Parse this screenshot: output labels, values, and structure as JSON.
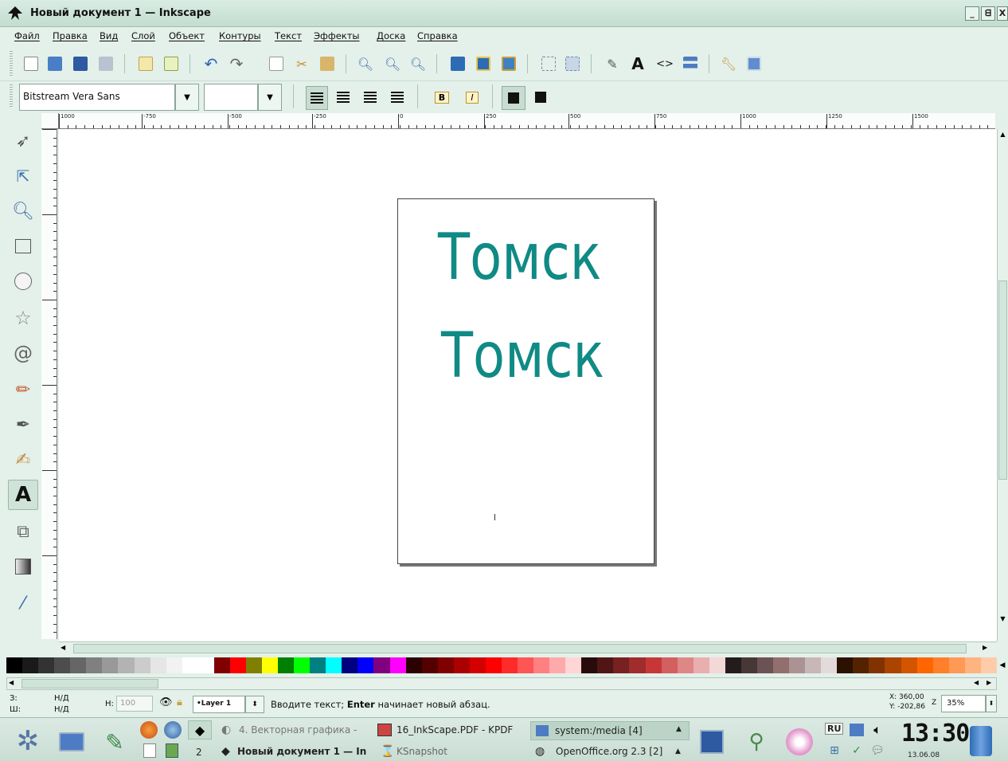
{
  "window": {
    "title": "Новый документ 1 — Inkscape",
    "controls": [
      "_",
      "ᗺ",
      "X"
    ]
  },
  "menu": [
    "Файл",
    "Правка",
    "Вид",
    "Слой",
    "Объект",
    "Контуры",
    "Текст",
    "Эффекты",
    "Доска",
    "Справка"
  ],
  "toolbar": {
    "icons": [
      "new-icon",
      "open-icon",
      "save-icon",
      "print-icon",
      "import-icon",
      "export-icon",
      "undo-icon",
      "redo-icon",
      "copy-icon",
      "cut-icon",
      "paste-icon",
      "zoom-selection-icon",
      "zoom-drawing-icon",
      "zoom-page-icon",
      "duplicate-icon",
      "clone-icon",
      "unlink-clone-icon",
      "group-icon",
      "ungroup-icon",
      "fill-stroke-icon",
      "text-font-icon",
      "xml-editor-icon",
      "align-icon",
      "preferences-icon",
      "document-properties-icon"
    ]
  },
  "text_toolbar": {
    "font_family": "Bitstream Vera Sans",
    "font_size": "",
    "bold_label": "B",
    "italic_label": "I"
  },
  "ruler": {
    "labels": [
      "1000",
      "-750",
      "-500",
      "-250",
      "0",
      "250",
      "500",
      "750",
      "1000",
      "1250",
      "1500"
    ]
  },
  "canvas": {
    "text_line_1": "Томск",
    "text_line_2": "Томск",
    "text_color": "#108a85"
  },
  "palette": [
    "#000000",
    "#1a1a1a",
    "#333333",
    "#4d4d4d",
    "#666666",
    "#808080",
    "#999999",
    "#b3b3b3",
    "#cccccc",
    "#e6e6e6",
    "#f2f2f2",
    "#ffffff",
    "#ffffff",
    "#800000",
    "#ff0000",
    "#808000",
    "#ffff00",
    "#008000",
    "#00ff00",
    "#008080",
    "#00ffff",
    "#000080",
    "#0000ff",
    "#800080",
    "#ff00ff",
    "#2b0000",
    "#550000",
    "#800000",
    "#aa0000",
    "#d40000",
    "#ff0000",
    "#ff2a2a",
    "#ff5555",
    "#ff8080",
    "#ffaaaa",
    "#ffd5d5",
    "#280b0b",
    "#501616",
    "#782121",
    "#a02c2c",
    "#c83737",
    "#d35f5f",
    "#de8787",
    "#e9afaf",
    "#f4d7d7",
    "#241c1c",
    "#483737",
    "#6c5353",
    "#916f6f",
    "#ac9393",
    "#c8b7b7",
    "#e3dbdb",
    "#2b1100",
    "#552200",
    "#803300",
    "#aa4400",
    "#d45500",
    "#ff6600",
    "#ff7f2a",
    "#ff9955",
    "#ffb380",
    "#ffccaa"
  ],
  "status": {
    "fill_label": "З:",
    "fill_value": "Н/Д",
    "stroke_label": "Ш:",
    "stroke_value": "Н/Д",
    "opacity_label": "Н:",
    "opacity_value": "100",
    "layer": "•Layer 1",
    "message_prefix": "Вводите текст;",
    "message_bold": "Enter",
    "message_suffix": "начинает новый абзац.",
    "x_coord": "X: 360,00",
    "y_coord": "Y: -202,86",
    "zoom_label": "Z",
    "zoom": "35%"
  },
  "taskbar": {
    "desktop_number": "2",
    "tasks": [
      {
        "label": "4. Векторная графика - ",
        "row": 1
      },
      {
        "label": "16_InkScape.PDF - KPDF",
        "row": 1
      },
      {
        "label": "system:/media [4]",
        "row": 1
      },
      {
        "label": "Новый документ 1 — In",
        "row": 2
      },
      {
        "label": "KSnapshot",
        "row": 2
      },
      {
        "label": "OpenOffice.org 2.3 [2]",
        "row": 2
      }
    ],
    "lang": "RU",
    "clock": "13:30",
    "date": "13.06.08"
  }
}
